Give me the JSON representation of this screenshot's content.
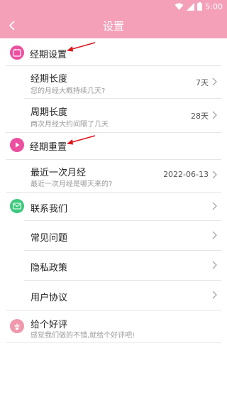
{
  "status_bar": {
    "time": "5:00"
  },
  "header": {
    "title": "设置"
  },
  "sections": {
    "period_settings": {
      "label": "经期设置"
    },
    "period_reset": {
      "label": "经期重置"
    }
  },
  "period_length": {
    "title": "经期长度",
    "subtitle": "您的月经大概持续几天?",
    "value": "7天"
  },
  "cycle_length": {
    "title": "周期长度",
    "subtitle": "两次月经大约间隔了几天",
    "value": "28天"
  },
  "last_period": {
    "title": "最近一次月经",
    "subtitle": "最近一次月经是哪天来的?",
    "value": "2022-06-13"
  },
  "menu": {
    "contact": "联系我们",
    "faq": "常见问题",
    "privacy": "隐私政策",
    "agreement": "用户协议"
  },
  "rate": {
    "title": "给个好评",
    "subtitle": "感觉我们做的不错,就给个好评吧!"
  },
  "colors": {
    "header_bg": "#f4a0b9",
    "arrow": "#e0151b",
    "icon_pink": "#ec4fa0",
    "icon_green": "#3bc97c",
    "icon_rose": "#f098ac"
  }
}
